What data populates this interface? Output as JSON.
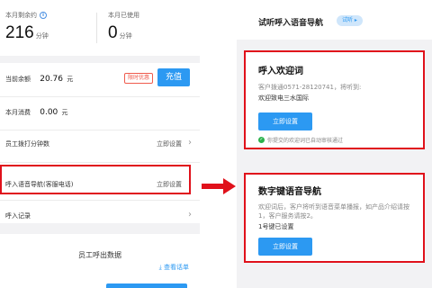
{
  "left": {
    "stats": {
      "remaining_label": "本月剩余约",
      "remaining_value": "216",
      "remaining_unit": "分钟",
      "used_label": "本月已使用",
      "used_value": "0",
      "used_unit": "分钟"
    },
    "balance": {
      "label": "当前余额",
      "value": "20.76",
      "unit": "元",
      "badge": "限时优惠",
      "charge_button": "充值"
    },
    "spend": {
      "label": "本月消费",
      "value": "0.00",
      "unit": "元"
    },
    "staff_minutes": {
      "label": "员工拨打分钟数",
      "action": "立即设置"
    },
    "ivr": {
      "label": "呼入语音导航(客服电话)",
      "action": "立即设置"
    },
    "inbound_log": {
      "label": "呼入记录"
    },
    "outbound": {
      "title": "员工呼出数据",
      "link": "查看话单"
    }
  },
  "right": {
    "header": {
      "title": "试听呼入语音导航",
      "tag": "试听"
    },
    "welcome": {
      "title": "呼入欢迎词",
      "desc": "客户拨通0571-28120741，将听到:",
      "text": "欢迎致电三水国际",
      "button": "立即设置",
      "status": "你提交的欢迎词已自动审核通过"
    },
    "digit_nav": {
      "title": "数字键语音导航",
      "desc": "欢迎词后，客户将听到语音菜单播报，如产品介绍请按1，客户服务请按2。",
      "status": "1号键已设置",
      "button": "立即设置"
    }
  },
  "colors": {
    "accent": "#2c99f2",
    "highlight": "#e0111b",
    "success": "#2bb24c"
  }
}
